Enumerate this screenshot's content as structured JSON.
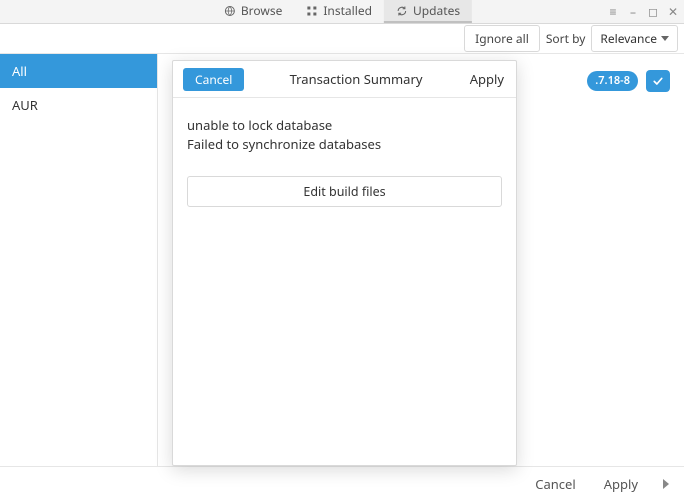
{
  "header": {
    "tabs": [
      {
        "label": "Browse",
        "icon": "globe-icon"
      },
      {
        "label": "Installed",
        "icon": "grid-icon"
      },
      {
        "label": "Updates",
        "icon": "refresh-icon"
      }
    ],
    "controls": [
      "menu-icon",
      "minimize-icon",
      "maximize-icon",
      "close-icon"
    ]
  },
  "toolbar": {
    "ignore_all": "Ignore all",
    "sort_label": "Sort by",
    "sort_value": "Relevance"
  },
  "sidebar": {
    "items": [
      {
        "label": "All",
        "selected": true
      },
      {
        "label": "AUR",
        "selected": false
      }
    ]
  },
  "content": {
    "package_badge": ".7.18-8"
  },
  "dialog": {
    "cancel": "Cancel",
    "title": "Transaction Summary",
    "apply": "Apply",
    "errors": [
      "unable to lock database",
      "Failed to synchronize databases"
    ],
    "edit_build": "Edit build files"
  },
  "footer": {
    "cancel": "Cancel",
    "apply": "Apply"
  }
}
